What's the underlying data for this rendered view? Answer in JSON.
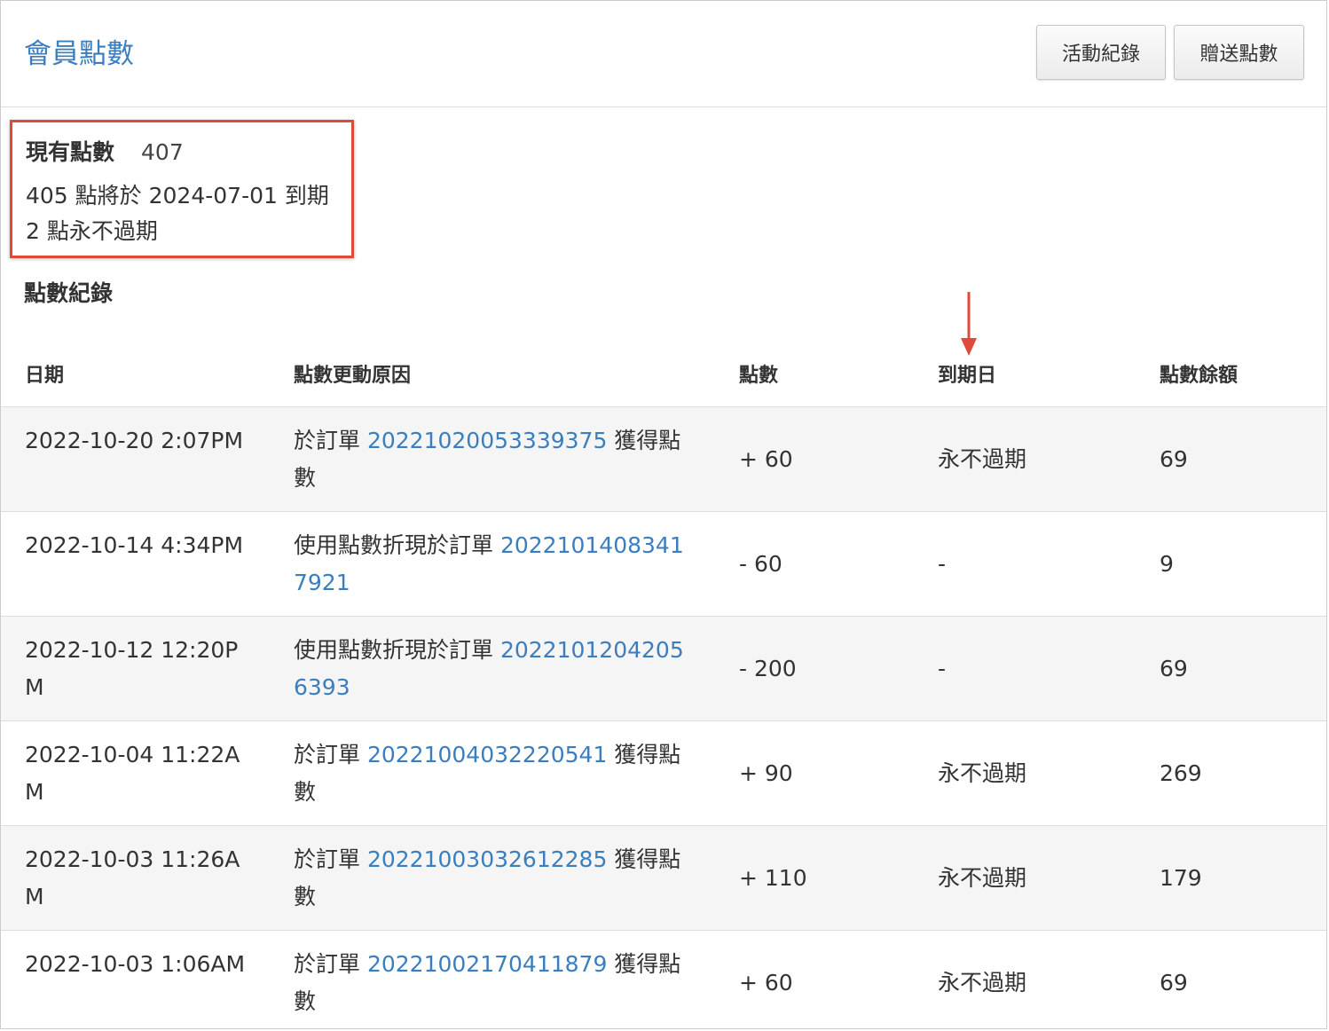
{
  "header": {
    "title": "會員點數",
    "buttons": {
      "activity_log": "活動紀錄",
      "gift_points": "贈送點數"
    }
  },
  "summary": {
    "current_label": "現有點數",
    "current_value": "407",
    "expiring_line": "405 點將於 2024-07-01 到期",
    "never_expire_line": "2 點永不過期"
  },
  "section_title": "點數紀錄",
  "colors": {
    "link": "#3a7ebf",
    "highlight_box": "#e04a3a",
    "arrow": "#e04a3a",
    "stripe": "#f5f5f5"
  },
  "table": {
    "headers": {
      "date": "日期",
      "reason": "點數更動原因",
      "points": "點數",
      "expiry": "到期日",
      "balance": "點數餘額"
    },
    "rows": [
      {
        "date": "2022-10-20 2:07PM",
        "reason_prefix": "於訂單 ",
        "order": "20221020053339375",
        "reason_suffix": " 獲得點數",
        "points": "+ 60",
        "expiry": "永不過期",
        "balance": "69"
      },
      {
        "date": "2022-10-14 4:34PM",
        "reason_prefix": "使用點數折現於訂單 ",
        "order": "20221014083417921",
        "reason_suffix": "",
        "points": "- 60",
        "expiry": "-",
        "balance": "9"
      },
      {
        "date": "2022-10-12 12:20PM",
        "reason_prefix": "使用點數折現於訂單 ",
        "order": "20221012042056393",
        "reason_suffix": "",
        "points": "- 200",
        "expiry": "-",
        "balance": "69"
      },
      {
        "date": "2022-10-04 11:22AM",
        "reason_prefix": "於訂單 ",
        "order": "20221004032220541",
        "reason_suffix": " 獲得點數",
        "points": "+ 90",
        "expiry": "永不過期",
        "balance": "269"
      },
      {
        "date": "2022-10-03 11:26AM",
        "reason_prefix": "於訂單 ",
        "order": "20221003032612285",
        "reason_suffix": " 獲得點數",
        "points": "+ 110",
        "expiry": "永不過期",
        "balance": "179"
      },
      {
        "date": "2022-10-03 1:06AM",
        "reason_prefix": "於訂單 ",
        "order": "20221002170411879",
        "reason_suffix": " 獲得點數",
        "points": "+ 60",
        "expiry": "永不過期",
        "balance": "69"
      }
    ]
  }
}
